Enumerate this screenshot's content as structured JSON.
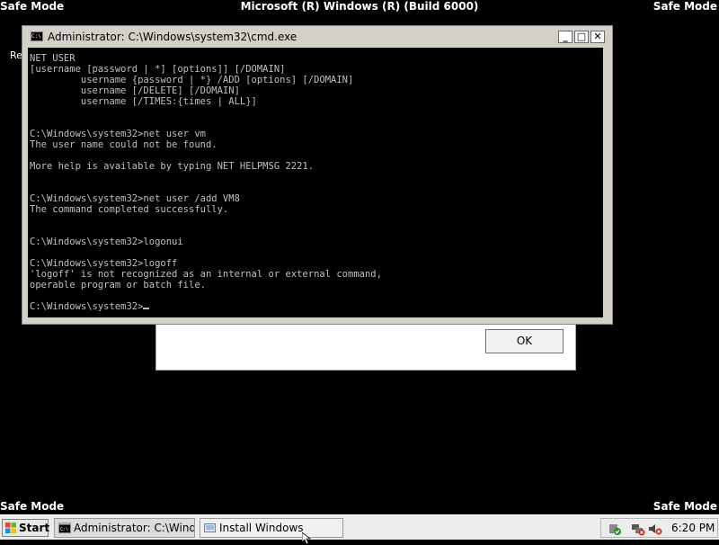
{
  "desktop": {
    "safe_mode_label": "Safe Mode",
    "title": "Microsoft (R) Windows (R) (Build 6000)",
    "fragment": "Re"
  },
  "dialog": {
    "ok_label": "OK"
  },
  "cmd_window": {
    "title": "Administrator: C:\\Windows\\system32\\cmd.exe",
    "icon_text": "C:\\",
    "minimize": "_",
    "maximize": "□",
    "close": "✕",
    "console_text": "NET USER\n[username [password | *] [options]] [/DOMAIN]\n         username {password | *} /ADD [options] [/DOMAIN]\n         username [/DELETE] [/DOMAIN]\n         username [/TIMES:{times | ALL}]\n\n\nC:\\Windows\\system32>net user vm\nThe user name could not be found.\n\nMore help is available by typing NET HELPMSG 2221.\n\n\nC:\\Windows\\system32>net user /add VM8\nThe command completed successfully.\n\n\nC:\\Windows\\system32>logonui\n\nC:\\Windows\\system32>logoff\n'logoff' is not recognized as an internal or external command,\noperable program or batch file.\n\nC:\\Windows\\system32>"
  },
  "taskbar": {
    "start_label": "Start",
    "tasks": [
      {
        "label": "Administrator: C:\\Windo...",
        "icon": "cmd-icon",
        "active": true
      },
      {
        "label": "Install Windows",
        "icon": "setup-icon",
        "active": false
      }
    ],
    "tray_icons": [
      "windows-defender-icon",
      "network-disconnected-icon",
      "volume-muted-icon"
    ],
    "clock": "6:20 PM"
  },
  "colors": {
    "desktop_background": "#000000",
    "console_background": "#000000",
    "console_text": "#c0c0c0",
    "window_chrome": "#d4d0c8",
    "taskbar": "#ececec"
  }
}
